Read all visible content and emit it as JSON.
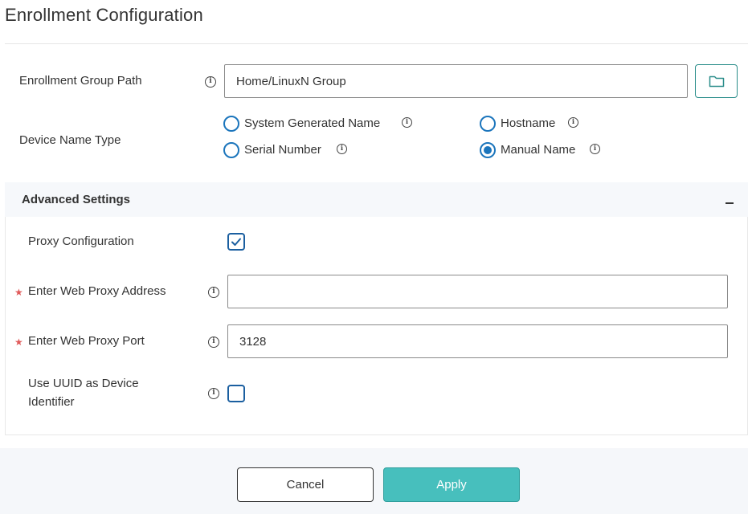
{
  "page": {
    "title": "Enrollment Configuration"
  },
  "enrollment_group": {
    "label": "Enrollment Group Path",
    "value": "Home/LinuxN Group",
    "folder_icon": "folder-icon"
  },
  "device_name_type": {
    "label": "Device Name Type",
    "options": [
      {
        "label": "System Generated Name",
        "selected": false
      },
      {
        "label": "Hostname",
        "selected": false
      },
      {
        "label": "Serial Number",
        "selected": false
      },
      {
        "label": "Manual Name",
        "selected": true
      }
    ]
  },
  "advanced": {
    "title": "Advanced Settings",
    "collapse_symbol": "–",
    "proxy_config": {
      "label": "Proxy Configuration",
      "checked": true
    },
    "proxy_address": {
      "label": "Enter Web Proxy Address",
      "value": "",
      "required": true
    },
    "proxy_port": {
      "label": "Enter Web Proxy Port",
      "value": "3128",
      "required": true
    },
    "uuid": {
      "label_line1": "Use UUID as Device",
      "label_line2": "Identifier",
      "checked": false
    }
  },
  "required_marker": "★",
  "info_glyph": "i",
  "footer": {
    "cancel_label": "Cancel",
    "apply_label": "Apply"
  },
  "colors": {
    "primary": "#1b75bc",
    "accent_teal": "#47bfbd",
    "required": "#e05a5a"
  }
}
